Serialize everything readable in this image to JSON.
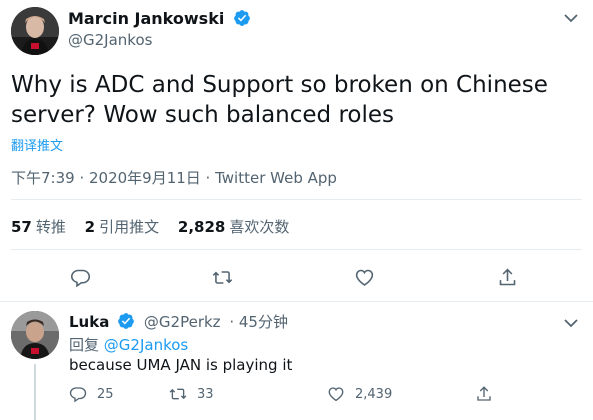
{
  "tweet": {
    "author": {
      "display_name": "Marcin Jankowski",
      "handle": "@G2Jankos",
      "verified": true
    },
    "text": "Why is ADC and Support so broken on Chinese server? Wow such balanced roles",
    "translate_label": "翻译推文",
    "timestamp": "下午7:39 · 2020年9月11日 · Twitter Web App",
    "stats": [
      {
        "value": "57",
        "label": "转推"
      },
      {
        "value": "2",
        "label": "引用推文"
      },
      {
        "value": "2,828",
        "label": "喜欢次数"
      }
    ],
    "actions": [
      "reply-icon",
      "retweet-icon",
      "like-icon",
      "share-icon"
    ]
  },
  "reply": {
    "author": {
      "display_name": "Luka",
      "handle": "@G2Perkz",
      "verified": true,
      "time": "45分钟"
    },
    "replying_to_prefix": "回复",
    "replying_to_handle": "@G2Jankos",
    "text": "because UMA JAN is playing it",
    "counts": {
      "replies": "25",
      "retweets": "33",
      "likes": "2,439"
    }
  },
  "colors": {
    "accent": "#1d9bf0",
    "text": "#0f1419",
    "secondary": "#536471",
    "divider": "#e6ecf0"
  }
}
